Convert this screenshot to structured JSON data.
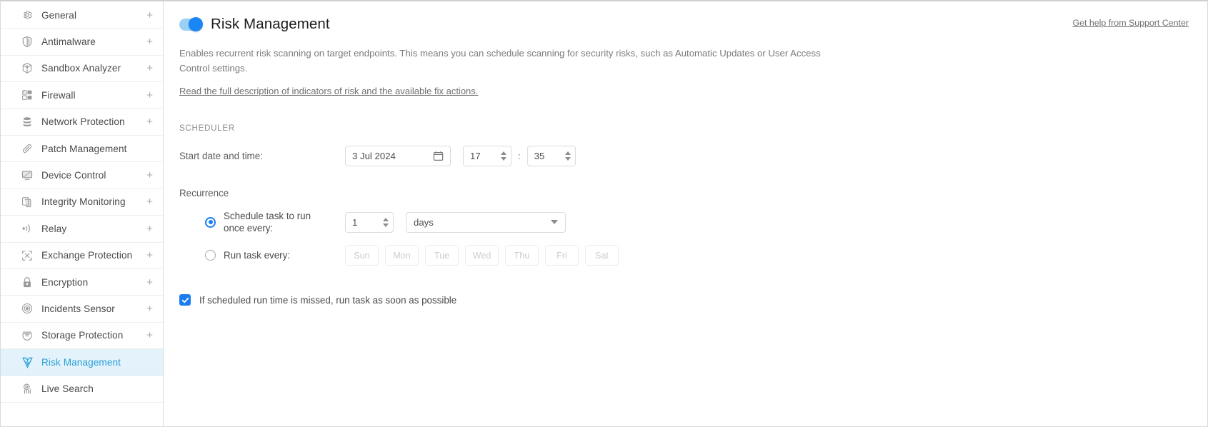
{
  "sidebar": {
    "items": [
      {
        "label": "General",
        "icon": "gear-icon",
        "expandable": true,
        "active": false
      },
      {
        "label": "Antimalware",
        "icon": "shield-icon",
        "expandable": true,
        "active": false
      },
      {
        "label": "Sandbox Analyzer",
        "icon": "cube-icon",
        "expandable": true,
        "active": false
      },
      {
        "label": "Firewall",
        "icon": "brick-wall-icon",
        "expandable": true,
        "active": false
      },
      {
        "label": "Network Protection",
        "icon": "database-icon",
        "expandable": true,
        "active": false
      },
      {
        "label": "Patch Management",
        "icon": "bandage-icon",
        "expandable": false,
        "active": false
      },
      {
        "label": "Device Control",
        "icon": "monitor-icon",
        "expandable": true,
        "active": false
      },
      {
        "label": "Integrity Monitoring",
        "icon": "documents-icon",
        "expandable": true,
        "active": false
      },
      {
        "label": "Relay",
        "icon": "broadcast-icon",
        "expandable": true,
        "active": false
      },
      {
        "label": "Exchange Protection",
        "icon": "exchange-icon",
        "expandable": true,
        "active": false
      },
      {
        "label": "Encryption",
        "icon": "lock-icon",
        "expandable": true,
        "active": false
      },
      {
        "label": "Incidents Sensor",
        "icon": "target-icon",
        "expandable": true,
        "active": false
      },
      {
        "label": "Storage Protection",
        "icon": "storage-icon",
        "expandable": true,
        "active": false
      },
      {
        "label": "Risk Management",
        "icon": "risk-shield-icon",
        "expandable": false,
        "active": true
      },
      {
        "label": "Live Search",
        "icon": "live-search-icon",
        "expandable": false,
        "active": false
      }
    ],
    "expand_symbol": "+"
  },
  "header": {
    "title": "Risk Management",
    "toggle_on": true,
    "support_link": "Get help from Support Center"
  },
  "content": {
    "description": "Enables recurrent risk scanning on target endpoints. This means you can schedule scanning for security risks, such as Automatic Updates or User Access Control settings.",
    "full_description_link": "Read the full description of indicators of risk and the available fix actions.",
    "scheduler_heading": "SCHEDULER",
    "start_datetime": {
      "label": "Start date and time:",
      "date_value": "3 Jul 2024",
      "hour_value": "17",
      "separator": ":",
      "minute_value": "35"
    },
    "recurrence": {
      "heading": "Recurrence",
      "option_once": {
        "label": "Schedule task to run once every:",
        "selected": true,
        "interval_value": "1",
        "unit_value": "days"
      },
      "option_weekly": {
        "label": "Run task every:",
        "selected": false,
        "days": [
          "Sun",
          "Mon",
          "Tue",
          "Wed",
          "Thu",
          "Fri",
          "Sat"
        ],
        "disabled": true
      }
    },
    "missed_run": {
      "label": "If scheduled run time is missed, run task as soon as possible",
      "checked": true
    }
  },
  "colors": {
    "accent_blue": "#1a7ef0",
    "sidebar_active_bg": "#e3f2fb",
    "sidebar_active_text": "#2a9fd8",
    "toggle_track": "#9bd0f5",
    "muted_text": "#7b7b7b"
  }
}
